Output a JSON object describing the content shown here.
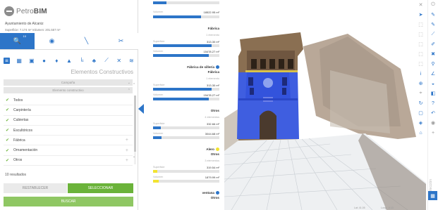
{
  "app": {
    "logo_text_a": "Petro",
    "logo_text_b": "BIM"
  },
  "project": {
    "name": "Ayuntamiento de Alcaniz",
    "stats": "Superficie: 7.174 m²   Volumen: 201.557 m³"
  },
  "mode_tabs": [
    {
      "icon": "search-icon",
      "glyph": "🔍",
      "badge": "10"
    },
    {
      "icon": "eye-icon",
      "glyph": "◉",
      "badge": ""
    },
    {
      "icon": "brush-icon",
      "glyph": "╲",
      "badge": ""
    },
    {
      "icon": "tools-icon",
      "glyph": "✂",
      "badge": ""
    }
  ],
  "category_icons": [
    {
      "name": "layers-icon",
      "glyph": "≡"
    },
    {
      "name": "grid-icon",
      "glyph": "▦"
    },
    {
      "name": "wall-icon",
      "glyph": "▣"
    },
    {
      "name": "sphere-icon",
      "glyph": "●"
    },
    {
      "name": "drop-icon",
      "glyph": "♦"
    },
    {
      "name": "roof-icon",
      "glyph": "▲"
    },
    {
      "name": "stairs-icon",
      "glyph": "╘"
    },
    {
      "name": "tree-icon",
      "glyph": "♣"
    },
    {
      "name": "slope-icon",
      "glyph": "⟋"
    },
    {
      "name": "beam-icon",
      "glyph": "✕"
    },
    {
      "name": "stack-icon",
      "glyph": "≋"
    }
  ],
  "panel": {
    "title": "Elementos Constructivos",
    "filter_1": "Campaña",
    "filter_2": "Elemento constructivo",
    "items": [
      "Todos",
      "Carpintería",
      "Cubiertas",
      "Escultóricos",
      "Fábrica",
      "Ornamentación",
      "Otros"
    ],
    "results": "10 resultados",
    "reset_label": "RESTABLECER",
    "select_label": "SELECCIONAR",
    "search_label": "BUSCAR"
  },
  "stats": {
    "top_label": "Volumen",
    "top_value": "18522.95 m³",
    "groups": [
      {
        "title": "Fábrica",
        "subtitle": "",
        "count": "1 elemento",
        "color": "#2d75c8",
        "sup_label": "Superficie",
        "sup_value": "313.30 m²",
        "sup_fill": 0.88,
        "vol_label": "Volumen",
        "vol_value": "15478.27 m³",
        "vol_fill": 0.84
      },
      {
        "title": "Fábrica de sillería",
        "subtitle": "Fábrica",
        "count": "1 elemento",
        "color": "#2d75c8",
        "sup_label": "Superficie",
        "sup_value": "313.30 m²",
        "sup_fill": 0.88,
        "vol_label": "Volumen",
        "vol_value": "15478.27 m³",
        "vol_fill": 0.84
      },
      {
        "title": "Otros",
        "subtitle": "",
        "count": "4 elementos",
        "color": "#2d75c8",
        "sup_label": "Superficie",
        "sup_value": "332.66 m²",
        "sup_fill": 0.12,
        "vol_label": "Volumen",
        "vol_value": "3044.68 m³",
        "vol_fill": 0.13
      },
      {
        "title": "Alero",
        "subtitle": "Otros",
        "count": "3 elementos",
        "color": "#f2e330",
        "sup_label": "Superficie",
        "sup_value": "319.54 m²",
        "sup_fill": 0.06,
        "vol_label": "Volumen",
        "vol_value": "1879.99 m³",
        "vol_fill": 0.08
      },
      {
        "title": "ventana",
        "subtitle": "Otros",
        "count": "",
        "color": "#2d75c8",
        "sup_label": "",
        "sup_value": "",
        "sup_fill": 0,
        "vol_label": "",
        "vol_value": "",
        "vol_fill": 0
      }
    ]
  },
  "viewport": {
    "coord_a": "Lat: 41.05",
    "coord_b": "Long: -0.13"
  },
  "toolbar_a": [
    {
      "name": "close-icon",
      "glyph": "✕",
      "gray": true
    },
    {
      "name": "cursor-icon",
      "glyph": "➤"
    },
    {
      "name": "box-select-icon",
      "glyph": "⬚",
      "gray": true
    },
    {
      "name": "box-select-2-icon",
      "glyph": "⬚",
      "gray": true
    },
    {
      "name": "box-select-3-icon",
      "glyph": "⬚",
      "gray": true
    },
    {
      "name": "box-select-4-icon",
      "glyph": "⬚",
      "gray": true
    },
    {
      "name": "box-select-5-icon",
      "glyph": "⬚",
      "gray": true
    },
    {
      "name": "info-icon",
      "glyph": "i"
    },
    {
      "name": "target-icon",
      "glyph": "⊕"
    },
    {
      "name": "crosshair-icon",
      "glyph": "⌖",
      "gray": true
    },
    {
      "name": "rotate-icon",
      "glyph": "↻"
    },
    {
      "name": "square-icon",
      "glyph": "▢"
    },
    {
      "name": "cube-icon",
      "glyph": "◈"
    },
    {
      "name": "home-icon",
      "glyph": "⌂"
    }
  ],
  "toolbar_b": [
    {
      "name": "power-icon",
      "glyph": "⏻",
      "gray": true
    },
    {
      "name": "pencil-icon",
      "glyph": "✎"
    },
    {
      "name": "pencil-2-icon",
      "glyph": "✎"
    },
    {
      "name": "measure-icon",
      "glyph": "⟋"
    },
    {
      "name": "paint-icon",
      "glyph": "✐"
    },
    {
      "name": "eraser-icon",
      "glyph": "✖"
    },
    {
      "name": "ruler-icon",
      "glyph": "⚲"
    },
    {
      "name": "angle-icon",
      "glyph": "∠"
    },
    {
      "name": "volume-icon",
      "glyph": "◒"
    },
    {
      "name": "area-icon",
      "glyph": "◧"
    },
    {
      "name": "help-icon",
      "glyph": "?"
    },
    {
      "name": "undo-icon",
      "glyph": "↶"
    },
    {
      "name": "eye-icon",
      "glyph": "◉",
      "gray": true
    },
    {
      "name": "plus-icon",
      "glyph": "+",
      "gray": true
    }
  ],
  "selection_vertical": "Selección"
}
